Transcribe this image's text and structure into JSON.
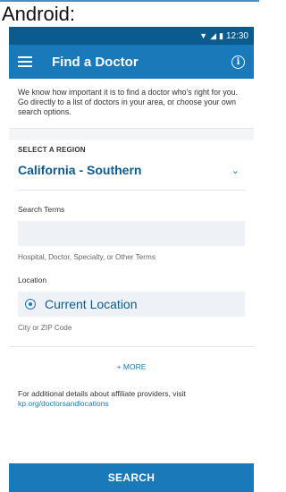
{
  "caption": "Android:",
  "status_bar": {
    "time": "12:30",
    "icons": [
      "wifi-icon",
      "signal-icon",
      "battery-icon"
    ]
  },
  "app_bar": {
    "title": "Find a Doctor",
    "menu_icon": "menu-icon",
    "info_icon": "info-icon"
  },
  "intro": "We know how important it is to find a doctor who's right for you. Go directly to a list of doctors in your area, or choose your own search options.",
  "region": {
    "label": "SELECT A REGION",
    "value": "California - Southern"
  },
  "search_terms": {
    "label": "Search Terms",
    "value": "",
    "hint": "Hospital, Doctor, Specialty, or Other Terms"
  },
  "location": {
    "label": "Location",
    "value": "Current Location",
    "hint": "City or ZIP Code"
  },
  "more_label": "+ MORE",
  "footer": {
    "text": "For additional details about affiliate providers, visit",
    "link": "kp.org/doctorsandlocations"
  },
  "search_button": "SEARCH",
  "colors": {
    "app_bar": "#1a79b8",
    "status_bar": "#0b5b8f",
    "accent": "#1a79b8"
  }
}
